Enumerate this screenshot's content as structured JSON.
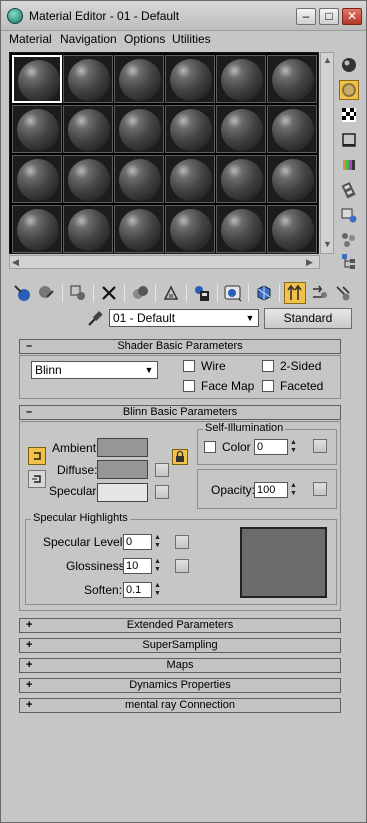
{
  "window": {
    "title": "Material Editor - 01 - Default",
    "min": "–",
    "max": "□",
    "close": "✕"
  },
  "menu": [
    "Material",
    "Navigation",
    "Options",
    "Utilities"
  ],
  "material": {
    "name": "01 - Default",
    "type_button": "Standard"
  },
  "shader_basic": {
    "header": "Shader Basic Parameters",
    "shader": "Blinn",
    "wire": "Wire",
    "two_sided": "2-Sided",
    "face_map": "Face Map",
    "faceted": "Faceted"
  },
  "blinn_basic": {
    "header": "Blinn Basic Parameters",
    "ambient": "Ambient:",
    "diffuse": "Diffuse:",
    "specular": "Specular:",
    "self_illum_title": "Self-Illumination",
    "color_label": "Color",
    "color_value": "0",
    "opacity_label": "Opacity:",
    "opacity_value": "100",
    "spec_highlights_title": "Specular Highlights",
    "spec_level_label": "Specular Level:",
    "spec_level_value": "0",
    "glossiness_label": "Glossiness:",
    "glossiness_value": "10",
    "soften_label": "Soften:",
    "soften_value": "0.1",
    "colors": {
      "ambient": "#969696",
      "diffuse": "#969696",
      "specular": "#e5e5e5",
      "highlight_preview": "#6b6b6b"
    }
  },
  "collapsed_rollouts": [
    "Extended Parameters",
    "SuperSampling",
    "Maps",
    "Dynamics Properties",
    "mental ray Connection"
  ],
  "rollout_symbols": {
    "expanded": "–",
    "collapsed": "+"
  },
  "icons": {
    "side_toolbar": [
      "sample-type-sphere-icon",
      "backlight-icon",
      "background-checker-icon",
      "sample-uv-tiling-icon",
      "video-color-check-icon",
      "make-preview-icon",
      "options-icon",
      "select-by-material-icon",
      "material-map-navigator-icon"
    ],
    "bottom_toolbar": [
      "get-material-icon",
      "put-to-scene-icon",
      "assign-to-selection-icon",
      "reset-map-icon",
      "make-unique-icon",
      "put-to-library-icon",
      "material-id-channel-icon",
      "show-map-in-viewport-icon",
      "show-end-result-icon",
      "go-to-parent-icon",
      "go-forward-to-sibling-icon",
      "pick-from-object-icon"
    ]
  }
}
